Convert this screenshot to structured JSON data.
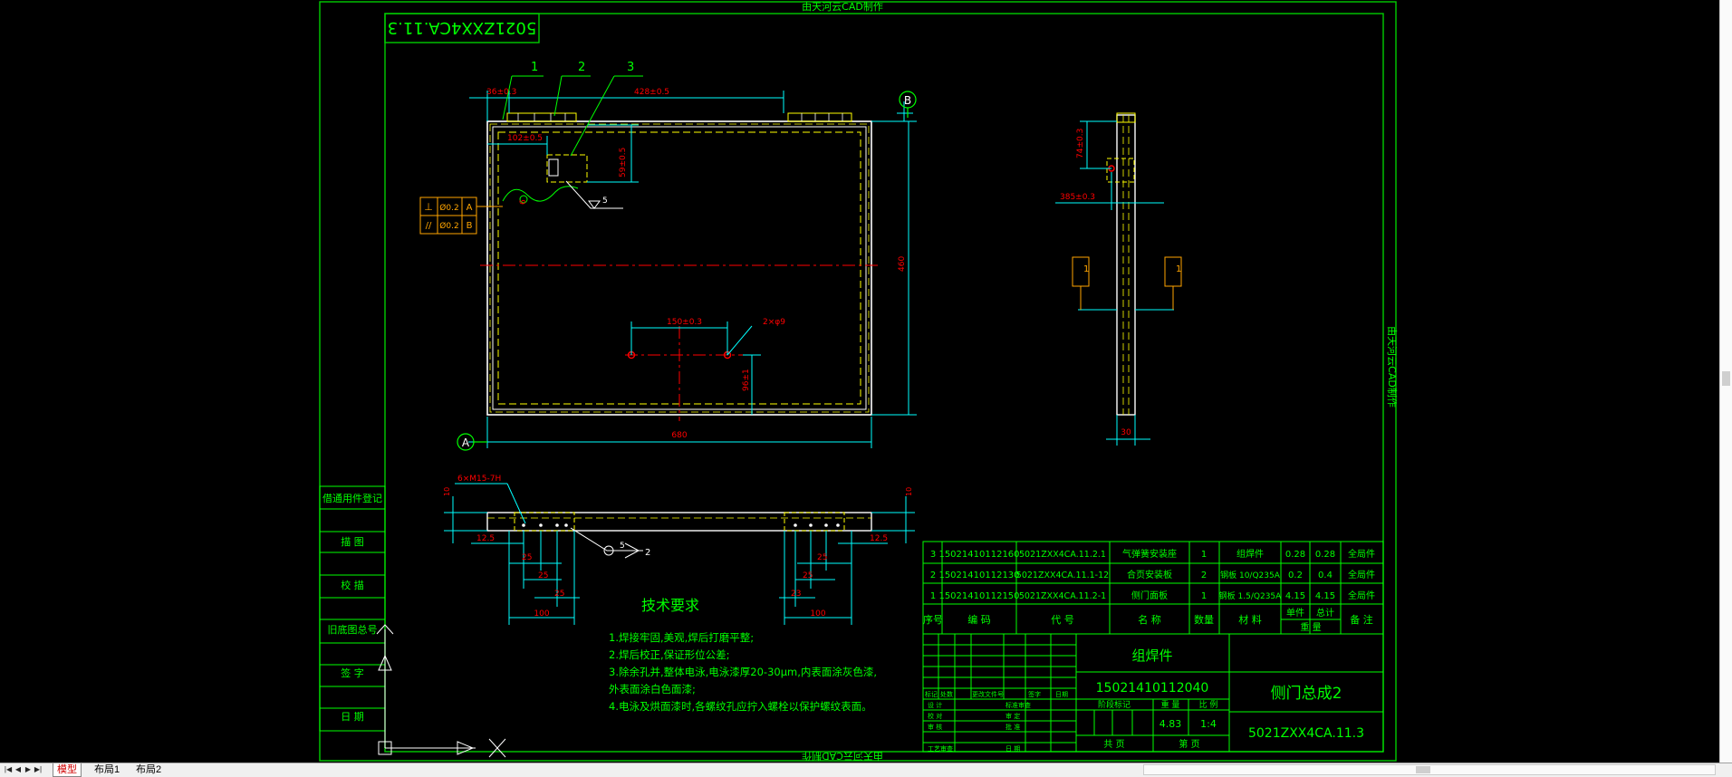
{
  "watermark": "由天河云CAD制作",
  "drawing_number_flipped": "5021ZXX4CA.11.3",
  "balloons": [
    "1",
    "2",
    "3"
  ],
  "datum_labels": [
    "A",
    "B"
  ],
  "front_view": {
    "dim_36": "36±0.3",
    "dim_428": "428±0.5",
    "dim_102": "102±0.5",
    "dim_59": "59±0.5",
    "dim_6": "6",
    "dim_150": "150±0.3",
    "dim_holes": "2×φ9",
    "dim_96": "96±1",
    "dim_460": "460",
    "dim_680": "680",
    "weld_5": "5"
  },
  "tolerances": [
    {
      "symbol": "⊥",
      "value": "Ø0.2",
      "datum": "A"
    },
    {
      "symbol": "//",
      "value": "Ø0.2",
      "datum": "B"
    }
  ],
  "side_view": {
    "dim_74": "74±0.3",
    "dim_385": "385±0.3",
    "dim_30": "30",
    "weld_1": "1"
  },
  "bottom_view": {
    "thread": "6×M15-7H",
    "dims": [
      "10",
      "10",
      "12.5",
      "12.5",
      "25",
      "25",
      "25",
      "25",
      "25",
      "23",
      "100",
      "100"
    ],
    "weld": "5",
    "weld_num": "2"
  },
  "tech_requirements": {
    "title": "技术要求",
    "items": [
      "1.焊接牢固,美观,焊后打磨平整;",
      "2.焊后校正,保证形位公差;",
      "3.除余孔并,整体电泳,电泳漆厚20-30μm,内表面涂灰色漆,",
      "   外表面涂白色面漆;",
      "4.电泳及烘面漆时,各螺纹孔应拧入螺栓以保护螺纹表面。"
    ]
  },
  "left_stamp": [
    "借通用件登记",
    "描 图",
    "校 描",
    "旧底图总号",
    "签 字",
    "日 期"
  ],
  "bom": {
    "headers": [
      "序号",
      "编 码",
      "代 号",
      "名 称",
      "数量",
      "材 料",
      "单件",
      "总计",
      "备 注"
    ],
    "weight_header": "重 量",
    "rows": [
      {
        "no": "3",
        "code": "15021410112160",
        "drawing": "5021ZXX4CA.11.2.1",
        "name": "气弹簧安装座",
        "qty": "1",
        "material": "组焊件",
        "unit": "0.28",
        "total": "0.28",
        "note": "全局件"
      },
      {
        "no": "2",
        "code": "15021410112130",
        "drawing": "5021ZXX4CA.11.1-12",
        "name": "合页安装板",
        "qty": "2",
        "material": "钢板 10/Q235A",
        "unit": "0.2",
        "total": "0.4",
        "note": "全局件"
      },
      {
        "no": "1",
        "code": "15021410112150",
        "drawing": "5021ZXX4CA.11.2-1",
        "name": "侧门面板",
        "qty": "1",
        "material": "钢板 1.5/Q235A",
        "unit": "4.15",
        "total": "4.15",
        "note": "全局件"
      }
    ]
  },
  "title_block": {
    "type": "组焊件",
    "part_code": "15021410112040",
    "name": "侧门总成2",
    "drawing_no": "5021ZXX4CA.11.3",
    "stage_header": [
      "阶段标记",
      "重 量",
      "比 例"
    ],
    "weight": "4.83",
    "scale": "1:4",
    "sheet": [
      "共 页",
      "第 页"
    ],
    "rev_header": [
      "标记",
      "处数",
      "更改文件号",
      "签字",
      "日期"
    ],
    "roles": [
      "设 计",
      "校 对",
      "审 核",
      "工艺审查"
    ],
    "roles2": [
      "标准审查",
      "审 定",
      "批 准",
      "日 期"
    ]
  },
  "tabs": [
    "模型",
    "布局1",
    "布局2"
  ],
  "colors": {
    "frame": "#00ff00",
    "outline": "#ffffff",
    "hidden": "#ffff00",
    "dimension": "#00ffff",
    "center": "#ff0000",
    "annotation": "#ffa500"
  }
}
